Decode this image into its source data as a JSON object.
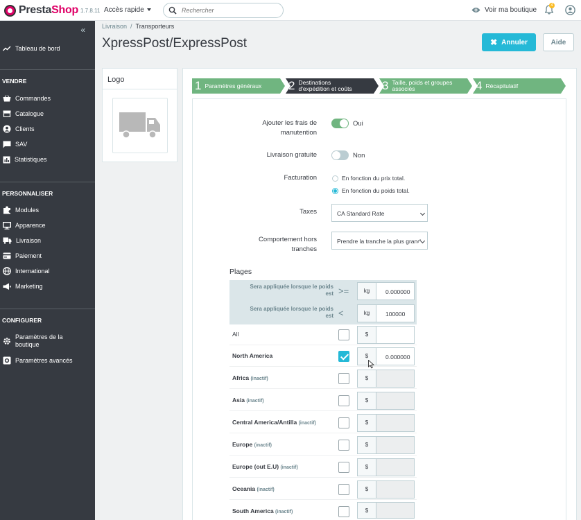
{
  "header": {
    "brand_prefix": "Presta",
    "brand_suffix": "Shop",
    "version": "1.7.8.11",
    "quick_access": "Accès rapide",
    "search_placeholder": "Rechercher",
    "view_shop": "Voir ma boutique",
    "notifications_count": "4",
    "icons": [
      "search-icon",
      "eye-icon",
      "bell-icon",
      "account-icon"
    ]
  },
  "sidebar": {
    "collapse": "«",
    "dashboard": "Tableau de bord",
    "sections": [
      {
        "title": "VENDRE",
        "items": [
          "Commandes",
          "Catalogue",
          "Clients",
          "SAV",
          "Statistiques"
        ]
      },
      {
        "title": "PERSONNALISER",
        "items": [
          "Modules",
          "Apparence",
          "Livraison",
          "Paiement",
          "International",
          "Marketing"
        ]
      },
      {
        "title": "CONFIGURER",
        "items": [
          "Paramètres de la boutique",
          "Paramètres avancés"
        ]
      }
    ]
  },
  "breadcrumb": {
    "parent": "Livraison",
    "current": "Transporteurs"
  },
  "page": {
    "title": "XpressPost/ExpressPost",
    "cancel": "Annuler",
    "help": "Aide"
  },
  "logo_card": {
    "title": "Logo"
  },
  "wizard": {
    "steps": [
      {
        "num": "1",
        "label": "Paramètres généraux"
      },
      {
        "num": "2",
        "label_line1": "Destinations",
        "label_line2": "d'expédition et coûts"
      },
      {
        "num": "3",
        "label_line1": "Taille, poids et groupes",
        "label_line2": "associés"
      },
      {
        "num": "4",
        "label": "Récapitulatif"
      }
    ],
    "colors": {
      "done": "#70b580",
      "active": "#363a41"
    }
  },
  "form": {
    "handling_label_1": "Ajouter les frais de",
    "handling_label_2": "manutention",
    "handling_value": "Oui",
    "free_label": "Livraison gratuite",
    "free_value": "Non",
    "billing_label": "Facturation",
    "billing_opt1": "En fonction du prix total.",
    "billing_opt2": "En fonction du poids total.",
    "tax_label": "Taxes",
    "tax_value": "CA Standard Rate",
    "outrange_label_1": "Comportement hors",
    "outrange_label_2": "tranches",
    "outrange_value": "Prendre la tranche la plus grande"
  },
  "ranges": {
    "title": "Plages",
    "from_label_1": "Sera appliquée lorsque le poids",
    "from_label_2": "est",
    "from_op": ">=",
    "to_op": "<",
    "unit": "kg",
    "from_value": "0.000000",
    "to_value": "100000",
    "currency": "$",
    "inactive": "(inactif)",
    "zones": [
      {
        "name": "All",
        "checked": false,
        "value": "",
        "active": true
      },
      {
        "name": "North America",
        "checked": true,
        "value": "0.000000",
        "active": true
      },
      {
        "name": "Africa",
        "checked": false,
        "value": "",
        "active": false
      },
      {
        "name": "Asia",
        "checked": false,
        "value": "",
        "active": false
      },
      {
        "name": "Central America/Antilla",
        "checked": false,
        "value": "",
        "active": false
      },
      {
        "name": "Europe",
        "checked": false,
        "value": "",
        "active": false
      },
      {
        "name": "Europe (out E.U)",
        "checked": false,
        "value": "",
        "active": false
      },
      {
        "name": "Oceania",
        "checked": false,
        "value": "",
        "active": false
      },
      {
        "name": "South America",
        "checked": false,
        "value": "",
        "active": false
      }
    ]
  },
  "colors": {
    "accent": "#25b9d7",
    "sidebar": "#363a41",
    "success": "#70b580",
    "brand": "#df0067"
  }
}
